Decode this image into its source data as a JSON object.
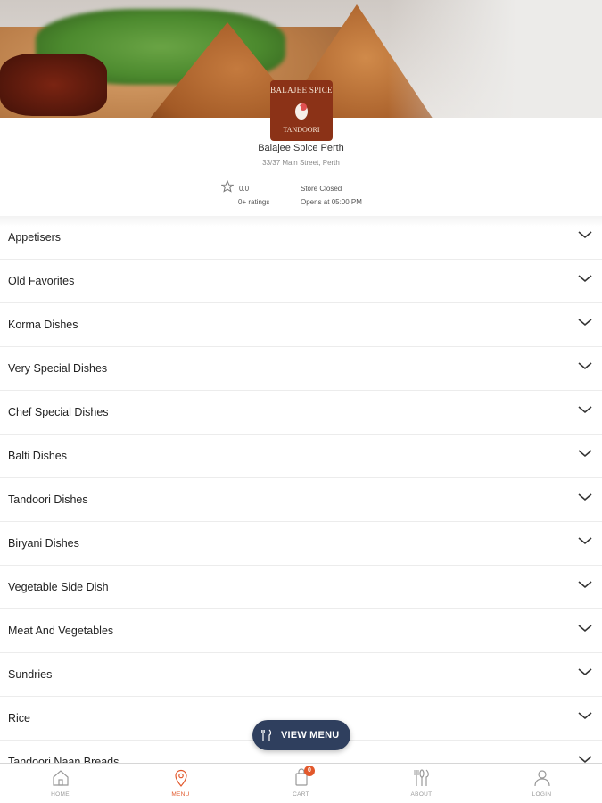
{
  "restaurant": {
    "logo_line1": "BALAJEE SPICE",
    "logo_line2": "TANDOORI",
    "name": "Balajee Spice Perth",
    "address": "33/37 Main Street, Perth",
    "rating": "0.0",
    "ratings_count": "0+ ratings",
    "status": "Store Closed",
    "opens": "Opens at 05:00 PM"
  },
  "categories": [
    "Appetisers",
    "Old Favorites",
    "Korma Dishes",
    "Very Special Dishes",
    "Chef Special Dishes",
    "Balti Dishes",
    "Tandoori Dishes",
    "Biryani Dishes",
    "Vegetable Side Dish",
    "Meat And Vegetables",
    "Sundries",
    "Rice",
    "Tandoori Naan Breads"
  ],
  "view_menu": {
    "label": "VIEW MENU",
    "icon": "cutlery-icon"
  },
  "tabs": [
    {
      "label": "HOME",
      "icon": "home-icon",
      "active": false
    },
    {
      "label": "MENU",
      "icon": "location-pin-icon",
      "active": true
    },
    {
      "label": "CART",
      "icon": "cart-icon",
      "active": false,
      "badge": "0"
    },
    {
      "label": "ABOUT",
      "icon": "cutlery-icon",
      "active": false
    },
    {
      "label": "LOGIN",
      "icon": "user-icon",
      "active": false
    }
  ],
  "colors": {
    "accent": "#e2582b",
    "fab": "#2f3f5e",
    "logo_bg": "#8b3217"
  }
}
